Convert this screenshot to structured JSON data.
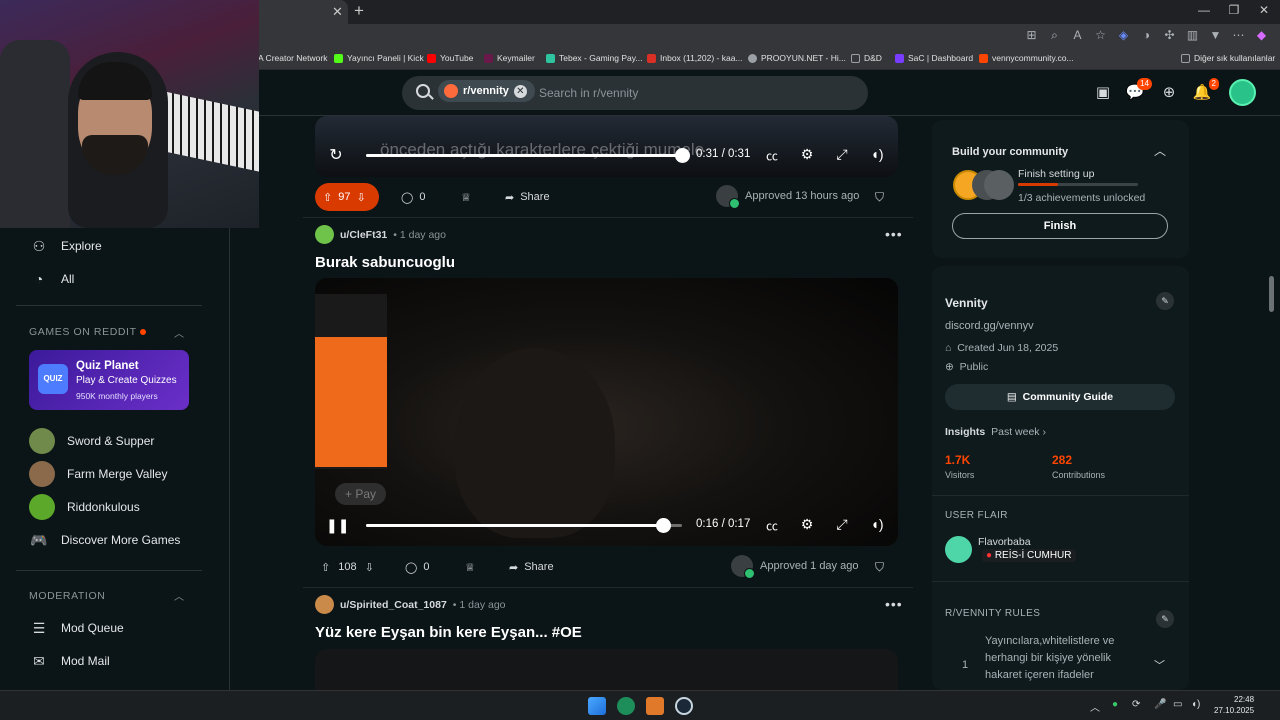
{
  "browser": {
    "bookmarks": [
      {
        "label": "A Creator Network",
        "color": "#2d2d2d"
      },
      {
        "label": "Yayıncı Paneli | Kick",
        "color": "#53fc18"
      },
      {
        "label": "YouTube",
        "color": "#ff0000"
      },
      {
        "label": "Keymailer",
        "color": "#6a1a4a"
      },
      {
        "label": "Tebex - Gaming Pay...",
        "color": "#2ec4a0"
      },
      {
        "label": "Inbox (11,202) - kaa...",
        "color": "#d93025"
      },
      {
        "label": "PROOYUN.NET - Hi...",
        "color": "#9aa0a6"
      },
      {
        "label": "D&D",
        "color": "#9aa0a6"
      },
      {
        "label": "SaC | Dashboard",
        "color": "#7a3cff"
      },
      {
        "label": "vennycommunity.co...",
        "color": "#ff4500"
      }
    ],
    "other_bookmarks": "Diğer sık kullanılanlar"
  },
  "header": {
    "subreddit_chip": "r/vennity",
    "search_placeholder": "Search in r/vennity",
    "chat_badge": "14",
    "notif_badge": "2"
  },
  "sidebar": {
    "explore": "Explore",
    "all": "All",
    "games_title": "GAMES ON REDDIT",
    "quiz": {
      "logo": "QUIZ",
      "title": "Quiz Planet",
      "subtitle": "Play & Create Quizzes",
      "players": "950K monthly players"
    },
    "games": [
      "Sword & Supper",
      "Farm Merge Valley",
      "Riddonkulous"
    ],
    "discover": "Discover More Games",
    "moderation_title": "MODERATION",
    "mod_queue": "Mod Queue",
    "mod_mail": "Mod Mail"
  },
  "feed": {
    "post1": {
      "caption": "önceden açtığı karakterlere çektiği mumele",
      "time": "0:31 / 0:31",
      "progress": 1.0,
      "votes": "97",
      "comments": "0",
      "share": "Share",
      "approved": "Approved 13 hours ago"
    },
    "post2": {
      "author": "u/CleFt31",
      "age": "• 1 day ago",
      "title": "Burak sabuncuoglu",
      "time": "0:16 / 0:17",
      "progress": 0.94,
      "overlay_btn": "+ Pay",
      "votes": "108",
      "comments": "0",
      "share": "Share",
      "approved": "Approved 1 day ago"
    },
    "post3": {
      "author": "u/Spirited_Coat_1087",
      "age": "• 1 day ago",
      "title": "Yüz kere Eyşan bin kere Eyşan... #OE"
    }
  },
  "right": {
    "build": {
      "title": "Build your community",
      "subtitle": "Finish setting up",
      "progress_text": "1/3 achievements unlocked",
      "progress": 0.33,
      "button": "Finish"
    },
    "about": {
      "name": "Vennity",
      "description": "discord.gg/vennyv",
      "created": "Created Jun 18, 2025",
      "visibility": "Public",
      "guide": "Community Guide",
      "insights": "Insights",
      "period": "Past week",
      "visitors_value": "1.7K",
      "visitors_label": "Visitors",
      "contrib_value": "282",
      "contrib_label": "Contributions"
    },
    "flair": {
      "title": "USER FLAIR",
      "username": "Flavorbaba",
      "flair": "REİS-İ CUMHUR"
    },
    "rules": {
      "title": "R/VENNITY RULES",
      "rule1_num": "1",
      "rule1_text": "Yayıncılara,whitelistlere ve herhangi bir kişiye yönelik hakaret içeren ifadeler"
    }
  },
  "taskbar": {
    "time": "22:48",
    "date": "27.10.2025"
  }
}
